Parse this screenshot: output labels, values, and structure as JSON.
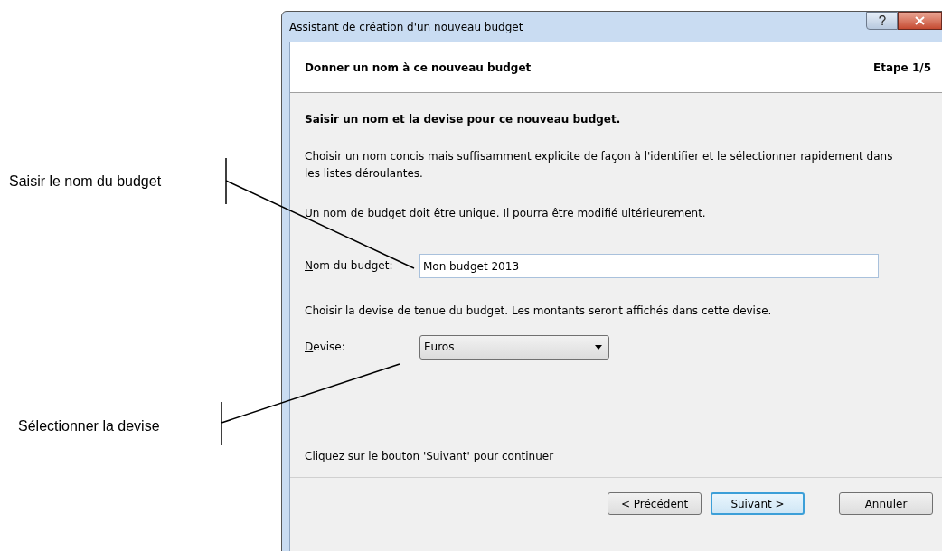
{
  "annotations": [
    {
      "text": "Saisir le nom du budget"
    },
    {
      "text": "Sélectionner la devise"
    }
  ],
  "window": {
    "title": "Assistant de création d'un nouveau budget"
  },
  "header": {
    "title": "Donner un nom à ce nouveau budget",
    "step": "Etape 1/5"
  },
  "content": {
    "heading": "Saisir un nom et la devise pour ce nouveau budget.",
    "paragraph_1": "Choisir un nom concis mais suffisamment explicite de façon à l'identifier et le sélectionner rapidement dans les listes déroulantes.",
    "paragraph_2": "Un nom de budget doit être unique. Il pourra être modifié ultérieurement.",
    "name_field": {
      "label": {
        "key": "N",
        "rest": "om du budget:"
      },
      "value": "Mon budget 2013"
    },
    "paragraph_3": "Choisir la devise de tenue du budget. Les montants seront affichés dans cette devise.",
    "currency_field": {
      "label": {
        "key": "D",
        "rest": "evise:"
      },
      "value": "Euros"
    },
    "footer_hint": "Cliquez sur le bouton 'Suivant' pour continuer"
  },
  "buttons": [
    {
      "label": {
        "prefix": "< ",
        "key": "P",
        "rest": "récédent"
      },
      "default": false
    },
    {
      "label": {
        "key": "S",
        "rest": "uivant >"
      },
      "default": true
    },
    {
      "label": {
        "rest": "Annuler"
      },
      "default": false
    }
  ]
}
